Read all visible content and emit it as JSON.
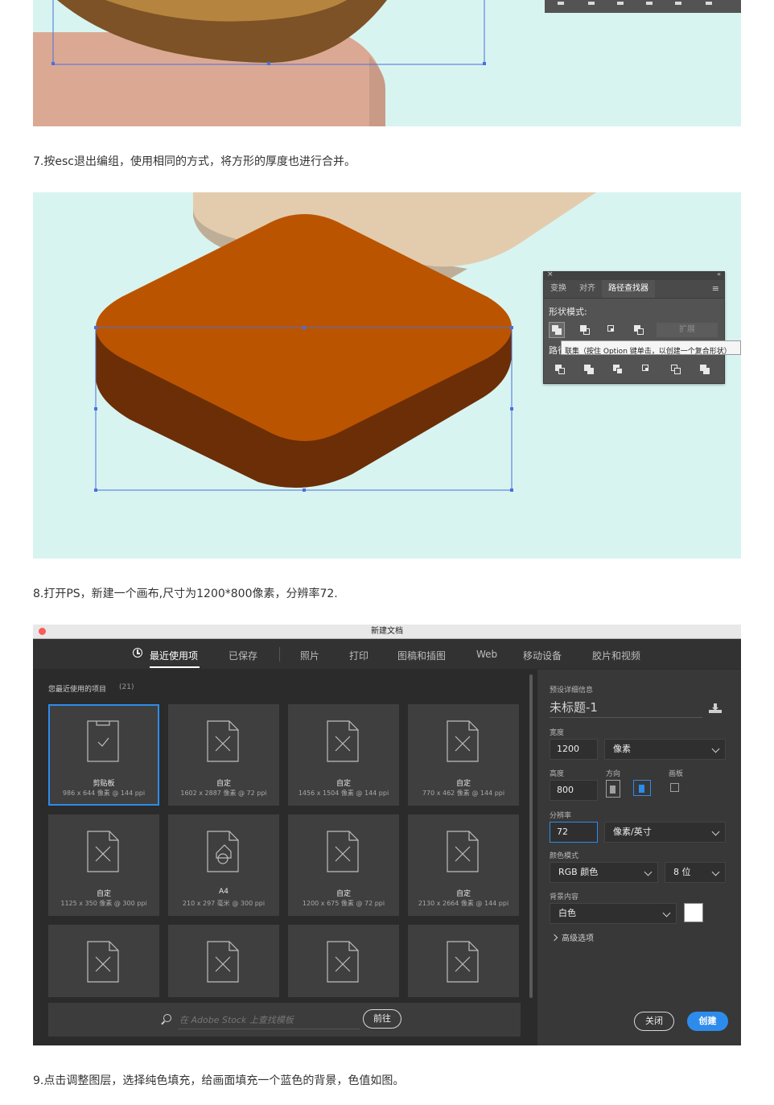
{
  "colors": {
    "canvas_bg": "#d8f4f1",
    "tile_top": "#bb5400",
    "tile_side": "#6b2e06",
    "ps_accent": "#2d8ceb"
  },
  "captions": {
    "step7": "7.按esc退出编组，使用相同的方式，将方形的厚度也进行合并。",
    "step8": "8.打开PS，新建一个画布,尺寸为1200*800像素，分辨率72.",
    "step9": "9.点击调整图层，选择纯色填充，给画面填充一个蓝色的背景，色值如图。"
  },
  "pathfinder": {
    "tabs": [
      "变换",
      "对齐",
      "路径查找器"
    ],
    "active_tab": "路径查找器",
    "shape_modes_label": "形状模式:",
    "expand_label": "扩展",
    "pathfinders_label": "路径查找器:",
    "tooltip": "联集（按住 Option 键单击，以创建一个复合形状）"
  },
  "ps_dialog": {
    "title": "新建文档",
    "tabs": [
      "最近使用项",
      "已保存",
      "照片",
      "打印",
      "图稿和插图",
      "Web",
      "移动设备",
      "胶片和视频"
    ],
    "recent_label": "您最近使用的项目",
    "recent_count": "(21)",
    "tiles": [
      {
        "name": "剪贴板",
        "dims": "986 x 644 像素 @ 144 ppi"
      },
      {
        "name": "自定",
        "dims": "1602 x 2887 像素 @ 72 ppi"
      },
      {
        "name": "自定",
        "dims": "1456 x 1504 像素 @ 144 ppi"
      },
      {
        "name": "自定",
        "dims": "770 x 462 像素 @ 144 ppi"
      },
      {
        "name": "自定",
        "dims": "1125 x 350 像素 @ 300 ppi"
      },
      {
        "name": "A4",
        "dims": "210 x 297 毫米 @ 300 ppi"
      },
      {
        "name": "自定",
        "dims": "1200 x 675 像素 @ 72 ppi"
      },
      {
        "name": "自定",
        "dims": "2130 x 2664 像素 @ 144 ppi"
      }
    ],
    "search_placeholder": "在 Adobe Stock 上查找模板",
    "go_button": "前往",
    "preset": {
      "section_label": "预设详细信息",
      "name": "未标题-1",
      "width_label": "宽度",
      "width": "1200",
      "width_unit": "像素",
      "height_label": "高度",
      "height": "800",
      "orientation_label": "方向",
      "artboard_label": "画板",
      "resolution_label": "分辨率",
      "resolution": "72",
      "resolution_unit": "像素/英寸",
      "color_mode_label": "颜色模式",
      "color_mode": "RGB 颜色",
      "bit_depth": "8 位",
      "background_label": "背景内容",
      "background": "白色",
      "advanced": "高级选项"
    },
    "close_button": "关闭",
    "create_button": "创建"
  }
}
